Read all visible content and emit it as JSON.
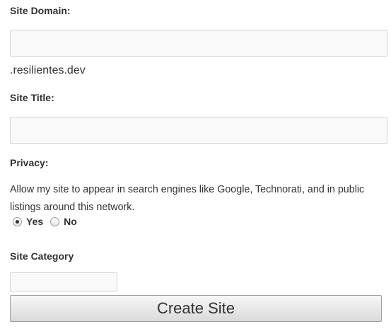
{
  "form": {
    "site_domain": {
      "label": "Site Domain:",
      "value": "",
      "suffix": ".resilientes.dev"
    },
    "site_title": {
      "label": "Site Title:",
      "value": ""
    },
    "privacy": {
      "label": "Privacy:",
      "description": "Allow my site to appear in search engines like Google, Technorati, and in public listings around this network.",
      "options": [
        {
          "label": "Yes",
          "checked": true
        },
        {
          "label": "No",
          "checked": false
        }
      ]
    },
    "site_category": {
      "label": "Site Category",
      "value": ""
    },
    "submit_label": "Create Site"
  }
}
